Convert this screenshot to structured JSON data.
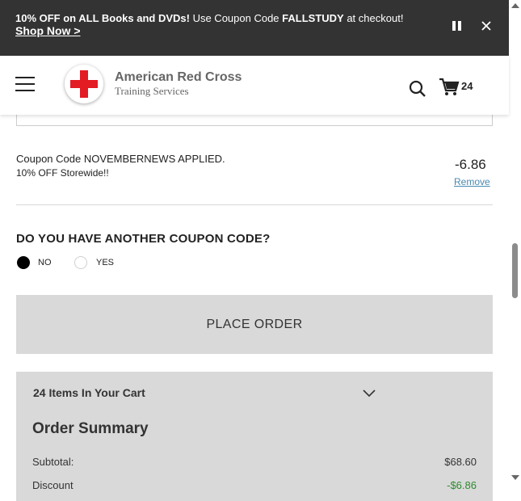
{
  "promo": {
    "part1": "10% OFF on ALL Books and DVDs!",
    "part2": " Use Coupon Code ",
    "code": "FALLSTUDY",
    "part3": " at checkout!",
    "link": "Shop Now >"
  },
  "header": {
    "logo_title": "American Red Cross",
    "logo_subtitle": "Training Services",
    "cart_count": "24"
  },
  "coupon": {
    "title": "Coupon Code NOVEMBERNEWS APPLIED.",
    "subtitle": "10% OFF Storewide!!",
    "amount": "-6.86",
    "remove_label": "Remove"
  },
  "another_coupon": {
    "question": "DO YOU HAVE ANOTHER COUPON CODE?",
    "options": [
      "NO",
      "YES"
    ],
    "selected": "NO"
  },
  "place_order_label": "PLACE ORDER",
  "summary": {
    "cart_items": "24 Items In Your Cart",
    "title": "Order Summary",
    "subtotal_label": "Subtotal:",
    "subtotal_value": "$68.60",
    "discount_label": "Discount",
    "discount_value": "-$6.86"
  },
  "colors": {
    "promo_bg": "#333333",
    "red_cross": "#e31b23",
    "link_blue": "#4a8ab0",
    "button_gray": "#d9d9d9",
    "discount_green": "#2e8b2e"
  }
}
